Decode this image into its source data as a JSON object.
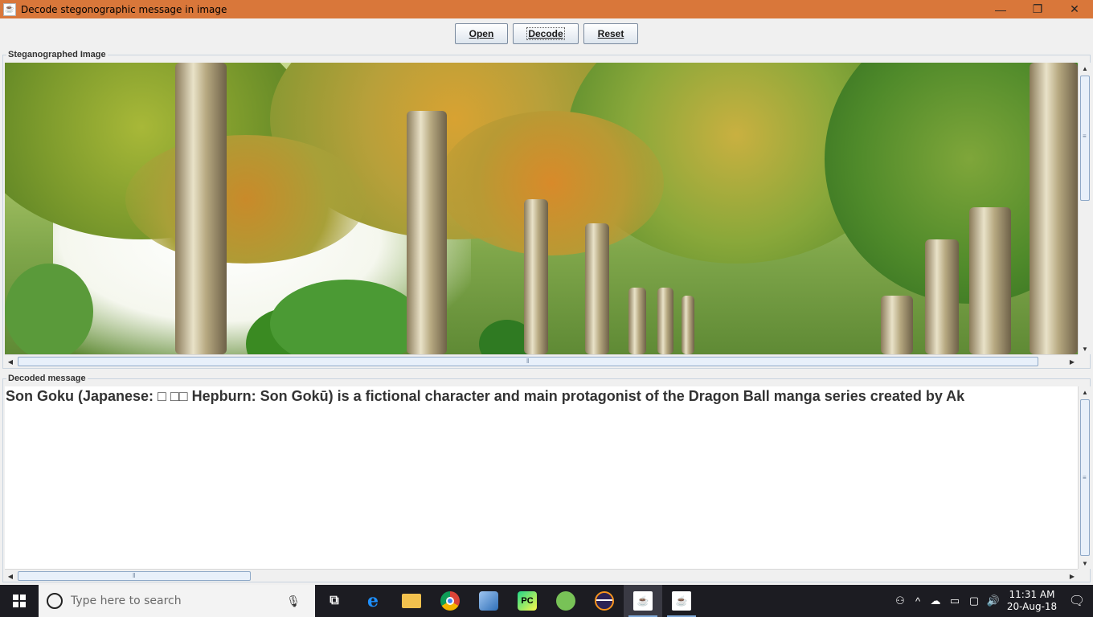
{
  "window": {
    "title": "Decode stegonographic message in image",
    "app_icon": "java-icon",
    "minimize_glyph": "—",
    "maximize_glyph": "❐",
    "close_glyph": "✕"
  },
  "toolbar": {
    "open_label": "Open",
    "decode_label": "Decode",
    "reset_label": "Reset"
  },
  "image_panel": {
    "title": "Steganographed Image",
    "image_subject": "tree-lined avenue with autumn foliage"
  },
  "message_panel": {
    "title": "Decoded message",
    "text": "Son Goku (Japanese: □ □□ Hepburn: Son Gokū) is a fictional character and main protagonist of the Dragon Ball manga series created by Ak"
  },
  "taskbar": {
    "search_placeholder": "Type here to search",
    "apps": [
      {
        "name": "task-view-icon",
        "label": ""
      },
      {
        "name": "edge-icon",
        "label": "e"
      },
      {
        "name": "file-explorer-icon",
        "label": ""
      },
      {
        "name": "chrome-icon",
        "label": ""
      },
      {
        "name": "virtualbox-icon",
        "label": ""
      },
      {
        "name": "pycharm-icon",
        "label": "PC"
      },
      {
        "name": "android-studio-icon",
        "label": ""
      },
      {
        "name": "eclipse-icon",
        "label": ""
      },
      {
        "name": "java-app-icon-1",
        "label": ""
      },
      {
        "name": "java-app-icon-2",
        "label": ""
      }
    ],
    "time": "11:31 AM",
    "date": "20-Aug-18"
  },
  "colors": {
    "titlebar": "#d9773a",
    "taskbar": "#1c1c22",
    "panel_border": "#c9d4df"
  }
}
